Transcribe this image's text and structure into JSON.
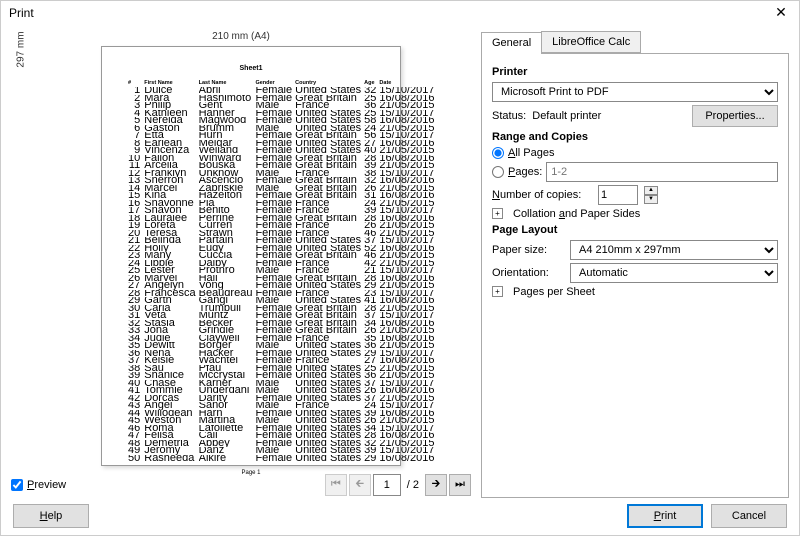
{
  "window": {
    "title": "Print"
  },
  "preview": {
    "ruler_top": "210 mm (A4)",
    "ruler_left": "297 mm",
    "sheet_title": "Sheet1",
    "page_label": "Page 1",
    "headers": [
      "#",
      "First Name",
      "Last Name",
      "Gender",
      "Country",
      "Age",
      "Date"
    ],
    "rows": [
      [
        "1",
        "Dulce",
        "Abril",
        "Female",
        "United States",
        "32",
        "15/10/2017"
      ],
      [
        "2",
        "Mara",
        "Hashimoto",
        "Female",
        "Great Britain",
        "25",
        "16/08/2016"
      ],
      [
        "3",
        "Philip",
        "Gent",
        "Male",
        "France",
        "36",
        "21/05/2015"
      ],
      [
        "4",
        "Kathleen",
        "Hanner",
        "Female",
        "United States",
        "25",
        "15/10/2017"
      ],
      [
        "5",
        "Nereida",
        "Magwood",
        "Female",
        "United States",
        "58",
        "16/08/2016"
      ],
      [
        "6",
        "Gaston",
        "Brumm",
        "Male",
        "United States",
        "24",
        "21/05/2015"
      ],
      [
        "7",
        "Etta",
        "Hurn",
        "Female",
        "Great Britain",
        "56",
        "15/10/2017"
      ],
      [
        "8",
        "Earlean",
        "Melgar",
        "Female",
        "United States",
        "27",
        "16/08/2016"
      ],
      [
        "9",
        "Vincenza",
        "Weiland",
        "Female",
        "United States",
        "40",
        "21/05/2015"
      ],
      [
        "10",
        "Fallon",
        "Winward",
        "Female",
        "Great Britain",
        "28",
        "16/08/2016"
      ],
      [
        "11",
        "Arcelia",
        "Bouska",
        "Female",
        "Great Britain",
        "39",
        "21/05/2015"
      ],
      [
        "12",
        "Franklyn",
        "Unknow",
        "Male",
        "France",
        "38",
        "15/10/2017"
      ],
      [
        "13",
        "Sherron",
        "Ascencio",
        "Female",
        "Great Britain",
        "32",
        "16/08/2016"
      ],
      [
        "14",
        "Marcel",
        "Zabriskie",
        "Male",
        "Great Britain",
        "26",
        "21/05/2015"
      ],
      [
        "15",
        "Kina",
        "Hazelton",
        "Female",
        "Great Britain",
        "31",
        "16/08/2016"
      ],
      [
        "16",
        "Shavonne",
        "Pia",
        "Female",
        "France",
        "24",
        "21/05/2015"
      ],
      [
        "17",
        "Shavon",
        "Benito",
        "Female",
        "France",
        "39",
        "15/10/2017"
      ],
      [
        "18",
        "Lauralee",
        "Perrine",
        "Female",
        "Great Britain",
        "28",
        "16/08/2016"
      ],
      [
        "19",
        "Loreta",
        "Curren",
        "Female",
        "France",
        "26",
        "21/05/2015"
      ],
      [
        "20",
        "Teresa",
        "Strawn",
        "Female",
        "France",
        "46",
        "21/05/2015"
      ],
      [
        "21",
        "Belinda",
        "Partain",
        "Female",
        "United States",
        "37",
        "15/10/2017"
      ],
      [
        "22",
        "Holly",
        "Eudy",
        "Female",
        "United States",
        "52",
        "16/08/2016"
      ],
      [
        "23",
        "Many",
        "Cuccia",
        "Female",
        "Great Britain",
        "46",
        "21/05/2015"
      ],
      [
        "24",
        "Libbie",
        "Dalby",
        "Female",
        "France",
        "42",
        "21/05/2015"
      ],
      [
        "25",
        "Lester",
        "Prothro",
        "Male",
        "France",
        "21",
        "15/10/2017"
      ],
      [
        "26",
        "Marvel",
        "Hail",
        "Female",
        "Great Britain",
        "28",
        "16/08/2016"
      ],
      [
        "27",
        "Angelyn",
        "Vong",
        "Female",
        "United States",
        "29",
        "21/05/2015"
      ],
      [
        "28",
        "Francesca",
        "Beaudreau",
        "Female",
        "France",
        "23",
        "15/10/2017"
      ],
      [
        "29",
        "Garth",
        "Gangi",
        "Male",
        "United States",
        "41",
        "16/08/2016"
      ],
      [
        "30",
        "Carla",
        "Trumbull",
        "Female",
        "Great Britain",
        "28",
        "21/05/2015"
      ],
      [
        "31",
        "Veta",
        "Muntz",
        "Female",
        "Great Britain",
        "37",
        "15/10/2017"
      ],
      [
        "32",
        "Stasia",
        "Becker",
        "Female",
        "Great Britain",
        "34",
        "16/08/2016"
      ],
      [
        "33",
        "Jona",
        "Grindle",
        "Female",
        "Great Britain",
        "26",
        "21/05/2015"
      ],
      [
        "34",
        "Judie",
        "Claywell",
        "Female",
        "France",
        "35",
        "16/08/2016"
      ],
      [
        "35",
        "Dewitt",
        "Borger",
        "Male",
        "United States",
        "36",
        "21/05/2015"
      ],
      [
        "36",
        "Nena",
        "Hacker",
        "Female",
        "United States",
        "29",
        "15/10/2017"
      ],
      [
        "37",
        "Kelsie",
        "Wachtel",
        "Female",
        "France",
        "27",
        "16/08/2016"
      ],
      [
        "38",
        "Sau",
        "Pfau",
        "Female",
        "United States",
        "25",
        "21/05/2015"
      ],
      [
        "39",
        "Shanice",
        "Mccrystal",
        "Female",
        "United States",
        "36",
        "21/05/2015"
      ],
      [
        "40",
        "Chase",
        "Karner",
        "Male",
        "United States",
        "37",
        "15/10/2017"
      ],
      [
        "41",
        "Tommie",
        "Underdahl",
        "Male",
        "United States",
        "26",
        "16/08/2016"
      ],
      [
        "42",
        "Dorcas",
        "Darity",
        "Female",
        "United States",
        "37",
        "21/05/2015"
      ],
      [
        "43",
        "Angel",
        "Sanor",
        "Male",
        "France",
        "24",
        "15/10/2017"
      ],
      [
        "44",
        "Willodean",
        "Harn",
        "Female",
        "United States",
        "39",
        "16/08/2016"
      ],
      [
        "45",
        "Weston",
        "Martina",
        "Male",
        "United States",
        "26",
        "21/05/2015"
      ],
      [
        "46",
        "Roma",
        "Lafollette",
        "Female",
        "United States",
        "34",
        "15/10/2017"
      ],
      [
        "47",
        "Felisa",
        "Cail",
        "Female",
        "United States",
        "28",
        "16/08/2016"
      ],
      [
        "48",
        "Demetria",
        "Abbey",
        "Female",
        "United States",
        "32",
        "21/05/2015"
      ],
      [
        "49",
        "Jeromy",
        "Danz",
        "Male",
        "United States",
        "39",
        "15/10/2017"
      ],
      [
        "50",
        "Rasheeda",
        "Alkire",
        "Female",
        "United States",
        "29",
        "16/08/2016"
      ]
    ]
  },
  "nav": {
    "preview_label": "Preview",
    "current_page": "1",
    "total_pages": "/ 2"
  },
  "tabs": {
    "general": "General",
    "calc": "LibreOffice Calc"
  },
  "printer": {
    "heading": "Printer",
    "selected": "Microsoft Print to PDF",
    "status_label": "Status:",
    "status_value": "Default printer",
    "properties": "Properties..."
  },
  "range": {
    "heading": "Range and Copies",
    "all_pages": "All Pages",
    "pages_label": "Pages:",
    "pages_placeholder": "1-2",
    "copies_label": "Number of copies:",
    "copies_value": "1",
    "collation": "Collation and Paper Sides"
  },
  "layout": {
    "heading": "Page Layout",
    "paper_label": "Paper size:",
    "paper_value": "A4 210mm x 297mm",
    "orient_label": "Orientation:",
    "orient_value": "Automatic",
    "pps": "Pages per Sheet"
  },
  "buttons": {
    "help": "Help",
    "print": "Print",
    "cancel": "Cancel"
  }
}
